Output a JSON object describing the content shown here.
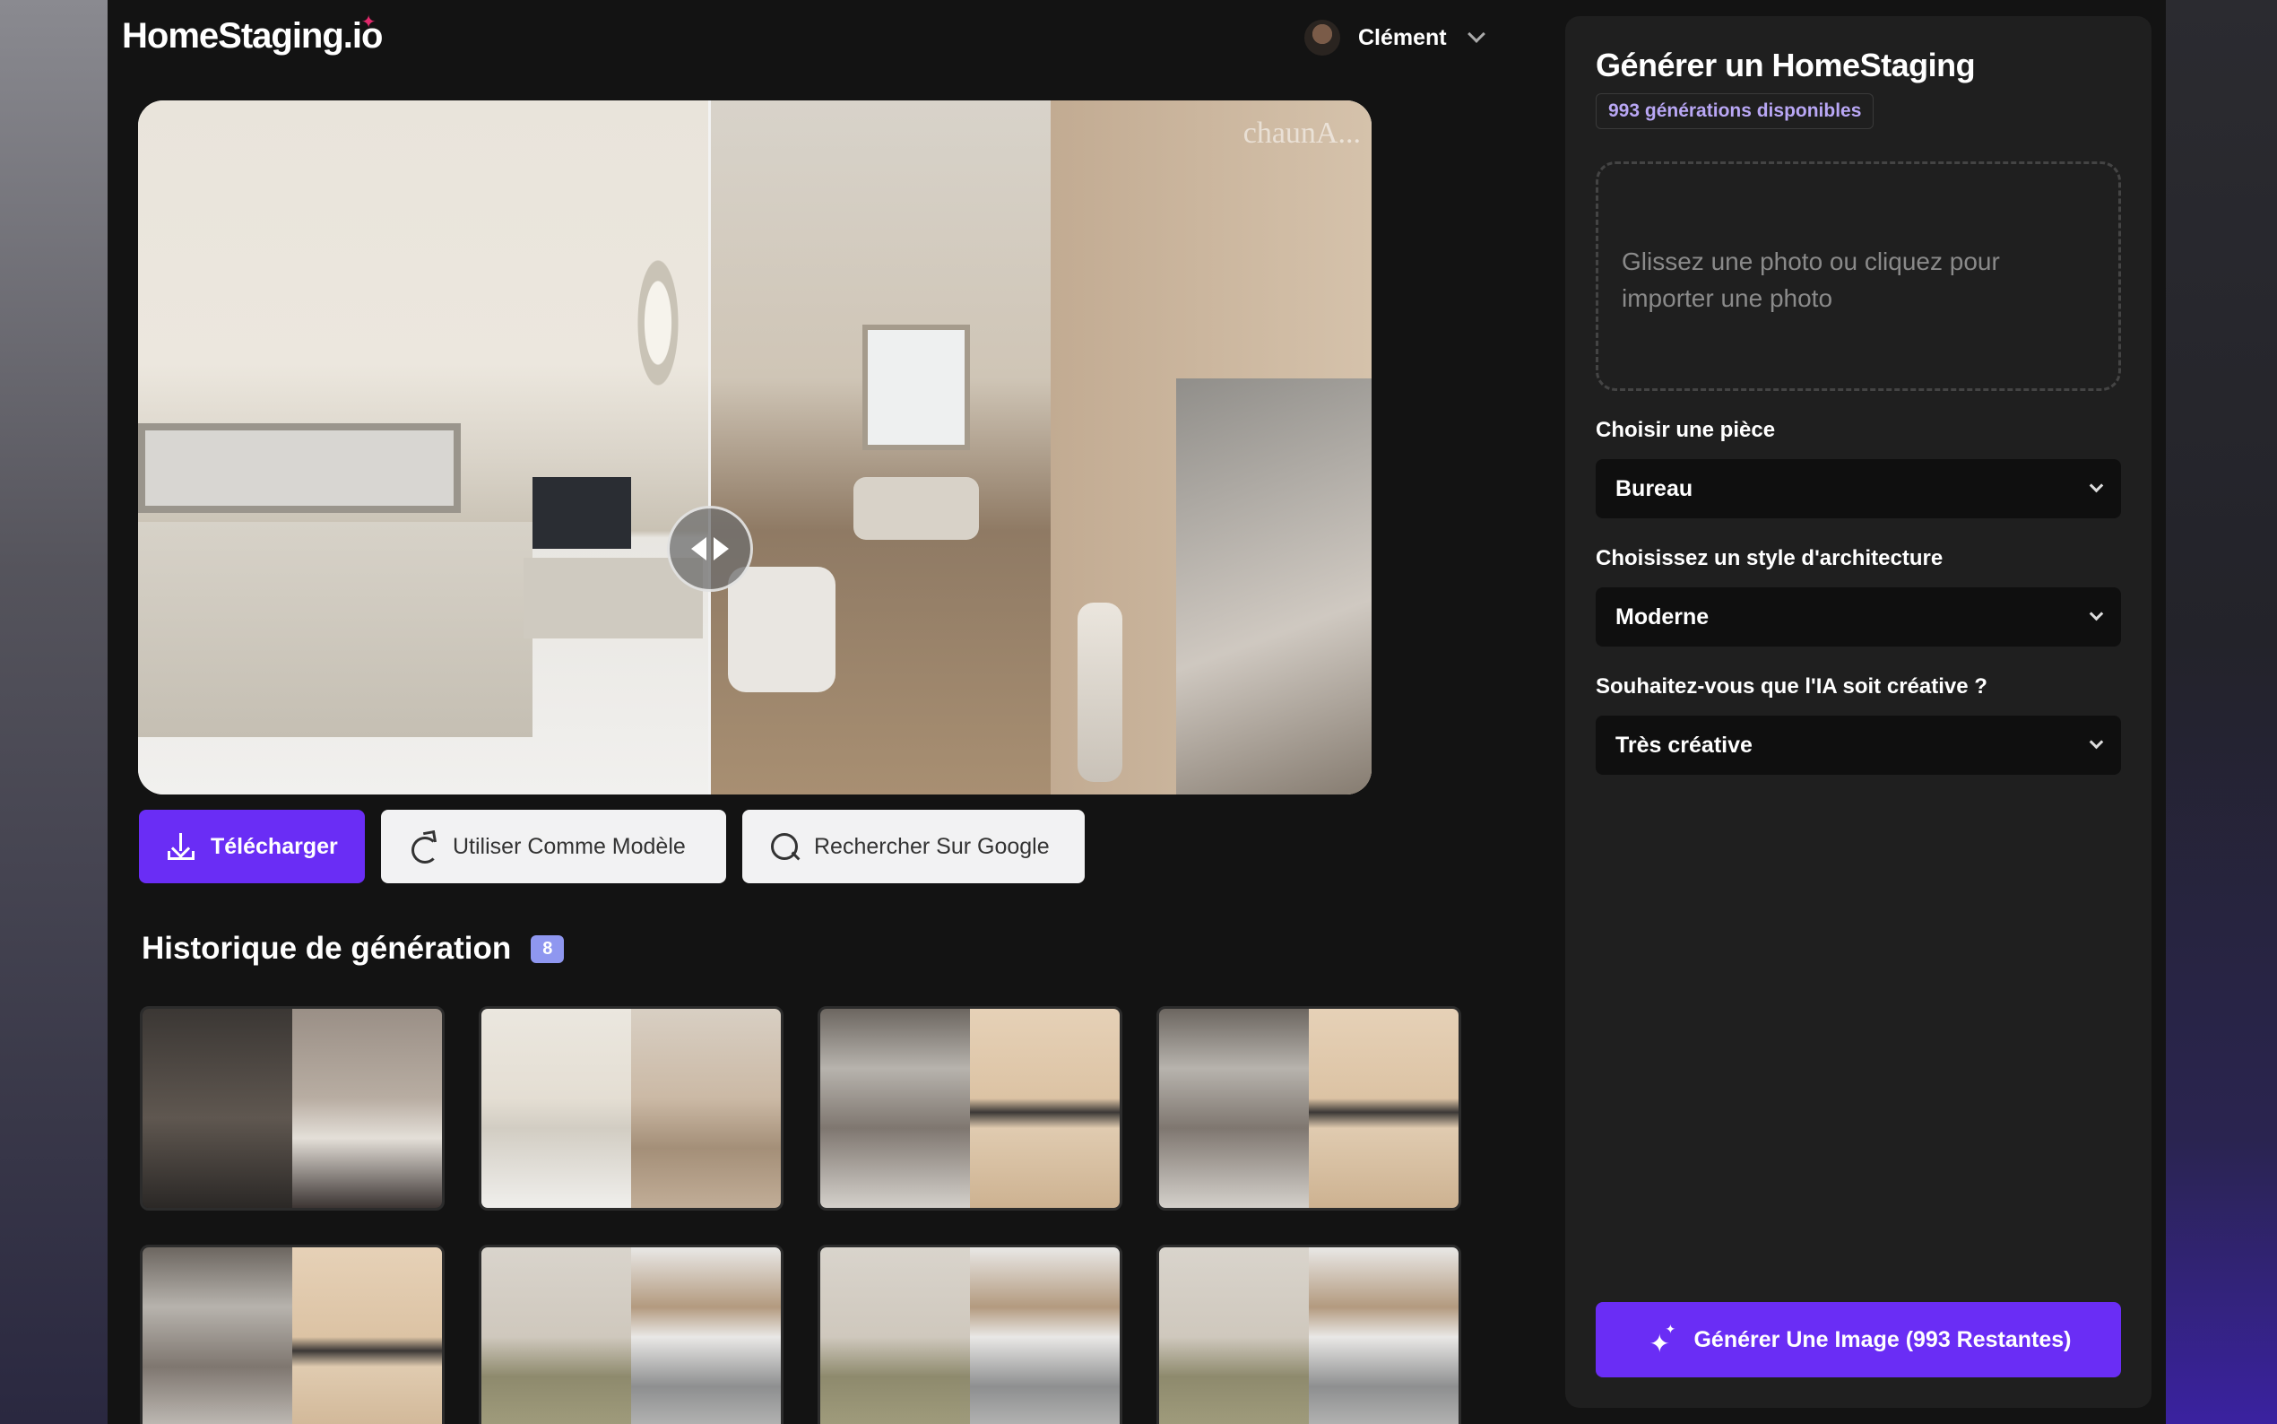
{
  "header": {
    "logo_text": "HomeStaging.io",
    "user_name": "Clément"
  },
  "viewer": {
    "watermark": "chaunA..."
  },
  "actions": {
    "download_label": "Télécharger",
    "use_as_template_label": "Utiliser Comme Modèle",
    "google_search_label": "Rechercher Sur Google"
  },
  "history": {
    "title": "Historique de génération",
    "count": "8",
    "items": [
      "bedroom",
      "living-room",
      "kitchen",
      "kitchen",
      "kitchen",
      "bedroom",
      "bedroom",
      "bedroom"
    ]
  },
  "sidebar": {
    "title": "Générer un HomeStaging",
    "credits": "993 générations disponibles",
    "dropzone_text": "Glissez une photo ou cliquez pour importer une photo",
    "room_label": "Choisir une pièce",
    "room_value": "Bureau",
    "style_label": "Choisissez un style d'architecture",
    "style_value": "Moderne",
    "creativity_label": "Souhaitez-vous que l'IA soit créative ?",
    "creativity_value": "Très créative",
    "generate_label": "Générer Une Image (993 Restantes)"
  },
  "colors": {
    "accent": "#6a2df5",
    "background": "#131313",
    "panel": "#1f1f1f",
    "badge": "#8f97f0"
  }
}
